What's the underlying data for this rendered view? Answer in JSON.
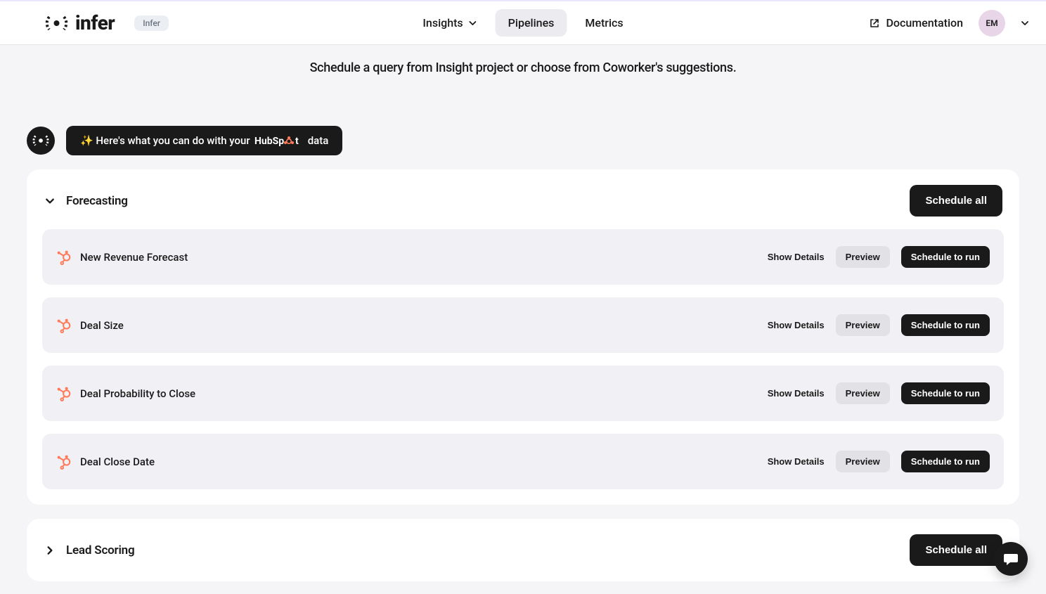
{
  "brand": {
    "wordmark": "infer",
    "env_tag": "Infer"
  },
  "nav": {
    "insights": "Insights",
    "pipelines": "Pipelines",
    "metrics": "Metrics"
  },
  "header": {
    "documentation": "Documentation",
    "user_initials": "EM"
  },
  "subtitle": "Schedule a query from Insight project or choose from Coworker's suggestions.",
  "suggestion_pill": {
    "prefix": "✨ Here's what you can do with your ",
    "integration": "HubSpot",
    "suffix": " data"
  },
  "buttons": {
    "schedule_all": "Schedule all",
    "show_details": "Show Details",
    "preview": "Preview",
    "schedule_to_run": "Schedule to run"
  },
  "sections": [
    {
      "title": "Forecasting",
      "expanded": true,
      "items": [
        {
          "name": "New Revenue Forecast"
        },
        {
          "name": "Deal Size"
        },
        {
          "name": "Deal Probability to Close"
        },
        {
          "name": "Deal Close Date"
        }
      ]
    },
    {
      "title": "Lead Scoring",
      "expanded": false
    }
  ]
}
